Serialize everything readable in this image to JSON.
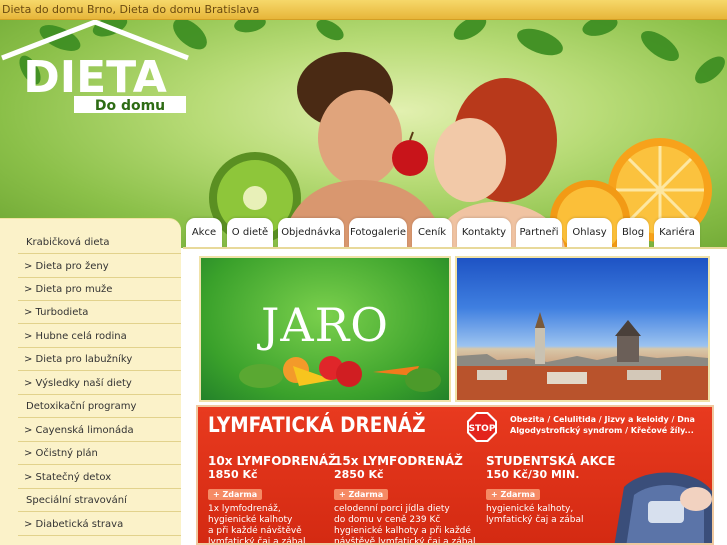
{
  "topbar": {
    "title": "Dieta do domu Brno, Dieta do domu Bratislava"
  },
  "logo": {
    "main": "DIETA",
    "sub": "Do domu"
  },
  "nav": {
    "tabs": [
      {
        "label": "Akce",
        "id": "akce"
      },
      {
        "label": "O dietě",
        "id": "o-diete"
      },
      {
        "label": "Objednávka",
        "id": "objednavka"
      },
      {
        "label": "Fotogalerie",
        "id": "fotogalerie"
      },
      {
        "label": "Ceník",
        "id": "cenik"
      },
      {
        "label": "Kontakty",
        "id": "kontakty"
      },
      {
        "label": "Partneři",
        "id": "partneri"
      },
      {
        "label": "Ohlasy",
        "id": "ohlasy"
      },
      {
        "label": "Blog",
        "id": "blog"
      },
      {
        "label": "Kariéra",
        "id": "kariera"
      }
    ]
  },
  "sidebar": {
    "items": [
      {
        "label": "Krabičková dieta",
        "id": "krabickova-dieta"
      },
      {
        "label": "> Dieta pro ženy",
        "id": "dieta-pro-zeny"
      },
      {
        "label": "> Dieta pro muže",
        "id": "dieta-pro-muze"
      },
      {
        "label": "> Turbodieta",
        "id": "turbodieta"
      },
      {
        "label": "> Hubne celá rodina",
        "id": "hubne-cela-rodina"
      },
      {
        "label": "> Dieta pro labužníky",
        "id": "dieta-pro-labizniky"
      },
      {
        "label": "> Výsledky naší diety",
        "id": "vysledky-nasi-diety"
      },
      {
        "label": "Detoxikační programy",
        "id": "detoxikacni-programy"
      },
      {
        "label": "> Cayenská limonáda",
        "id": "cayenska-limonada"
      },
      {
        "label": "> Očistný plán",
        "id": "ocistny-plan"
      },
      {
        "label": "> Statečný detox",
        "id": "statecny-detox"
      },
      {
        "label": "Speciální stravování",
        "id": "specialni-stravovani"
      },
      {
        "label": "> Diabetická strava",
        "id": "diabeticka-strava"
      }
    ]
  },
  "promos": {
    "jaro": {
      "label": "JARO"
    }
  },
  "lymfa": {
    "title": "LYMFATICKÁ DRENÁŽ",
    "stop": "STOP",
    "tags": "Obezita / Celulitida / Jizvy a keloidy / Dna\nAlgodystrofický syndrom / Křečové žíly...",
    "columns": [
      {
        "head": "10x LYMFODRENÁŽ",
        "price": "1850 Kč",
        "free": "+ Zdarma",
        "text": "1x lymfodrenáž,\nhygienické kalhoty\na při každé návštěvě\nlymfatický čaj a zábal"
      },
      {
        "head": "15x LYMFODRENÁŽ",
        "price": "2850 Kč",
        "free": "+ Zdarma",
        "text": "celodenní porci jídla diety\ndo domu v ceně 239 Kč\nhygienické kalhoty a při každé\nnávštěvě lymfatický čaj a zábal"
      },
      {
        "head": "STUDENTSKÁ AKCE",
        "price": "150 Kč/30 MIN.",
        "free": "+ Zdarma",
        "text": "hygienické kalhoty,\nlymfatický čaj a zábal"
      }
    ]
  },
  "colors": {
    "topbar": "#e7b63a",
    "sidebar_bg": "#fbf2c9",
    "banner_red": "#d42a12",
    "header_green": "#8bc049"
  }
}
